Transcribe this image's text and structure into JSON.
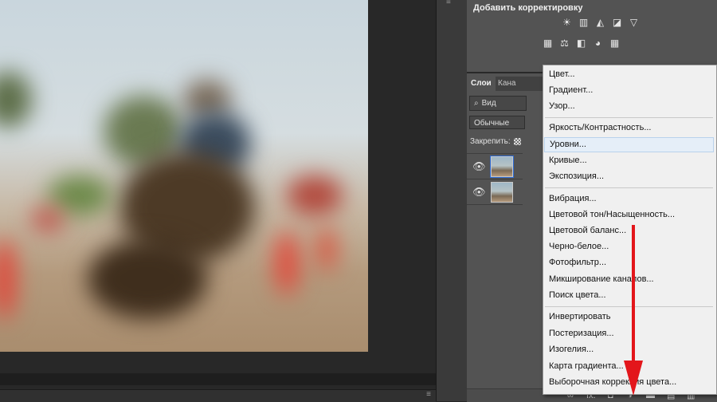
{
  "colors": {
    "app_dark": "#262626",
    "panel": "#535353",
    "menu_bg": "#f0f0f0",
    "highlight": "#e5eef8",
    "arrow": "#e3161b"
  },
  "adjustments": {
    "title": "Добавить корректировку",
    "row1_icons": [
      "☀",
      "▥",
      "◭",
      "◪",
      "▽"
    ],
    "row2_icons": [
      "▦",
      "⚖",
      "◧",
      "◕",
      "▦"
    ]
  },
  "layers": {
    "tabs": [
      "Слои",
      "Кана"
    ],
    "search_label": "Вид",
    "search_icon": "⌕",
    "blend_mode": "Обычные",
    "lock_label": "Закрепить:",
    "eye_icon": "👁"
  },
  "footer_icons": [
    "∞",
    "fx.",
    "◘",
    "◑",
    "▬",
    "▤",
    "▥"
  ],
  "context_menu": {
    "groups": [
      [
        "Цвет...",
        "Градиент...",
        "Узор..."
      ],
      [
        "Яркость/Контрастность...",
        "Уровни...",
        "Кривые...",
        "Экспозиция..."
      ],
      [
        "Вибрация...",
        "Цветовой тон/Насыщенность...",
        "Цветовой баланс...",
        "Черно-белое...",
        "Фотофильтр...",
        "Микширование каналов...",
        "Поиск цвета..."
      ],
      [
        "Инвертировать",
        "Постеризация...",
        "Изогелия...",
        "Карта градиента...",
        "Выборочная коррекция цвета..."
      ]
    ],
    "highlighted": "Уровни..."
  },
  "misc": {
    "menu_glyph": "≡",
    "strip_glyph": "≡"
  }
}
